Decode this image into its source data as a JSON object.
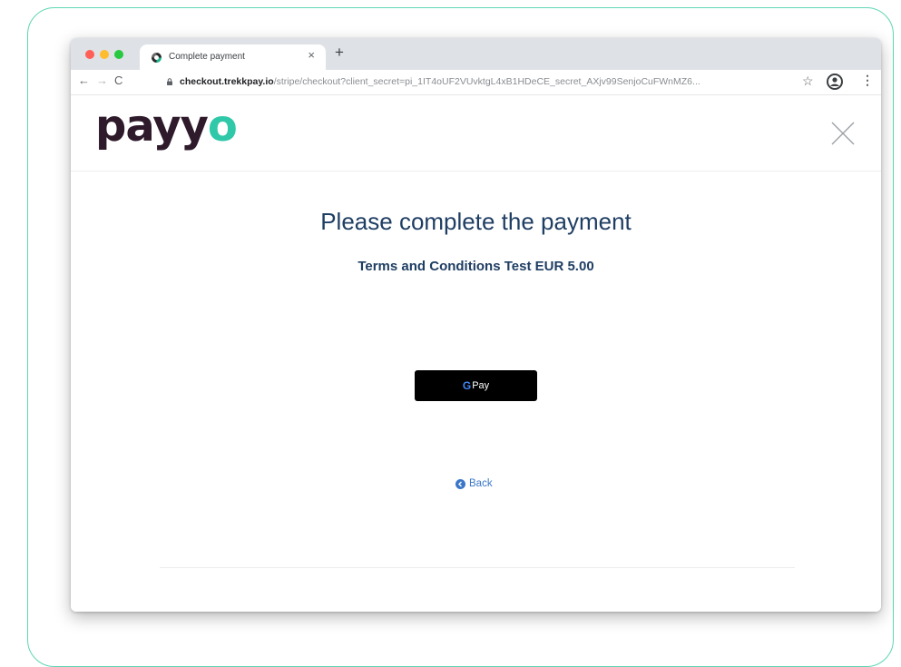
{
  "browser": {
    "tab_title": "Complete payment",
    "tab_close": "×",
    "new_tab": "+",
    "url_host": "checkout.trekkpay.io",
    "url_path": "/stripe/checkout?client_secret=pi_1IT4oUF2VUvktgL4xB1HDeCE_secret_AXjv99SenjoCuFWnMZ6...",
    "icons": {
      "back": "←",
      "forward": "→",
      "reload": "C",
      "star": "☆",
      "menu": "⋮"
    }
  },
  "header": {
    "logo_main": "payy",
    "logo_accent": "o"
  },
  "main": {
    "heading": "Please complete the payment",
    "subheading_text": "Terms and Conditions Test ",
    "subheading_amount": "EUR 5.00",
    "gpay_g": "G",
    "gpay_label": "Pay",
    "back_label": "Back"
  },
  "colors": {
    "frame_border": "#5ed6b4",
    "heading": "#1f3e63",
    "link": "#3b77c9",
    "logo_dark": "#2e1a2a",
    "logo_accent": "#2fc8a8"
  }
}
